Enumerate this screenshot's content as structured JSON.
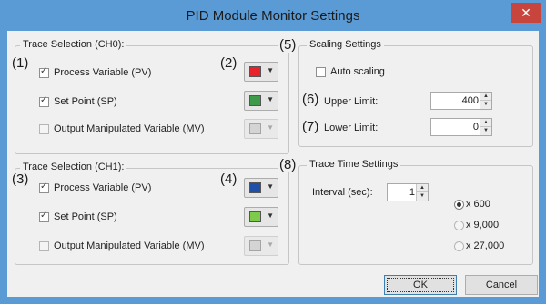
{
  "window": {
    "title": "PID Module Monitor Settings",
    "close_glyph": "✕"
  },
  "colors": {
    "frame": "#5b9bd5",
    "close": "#c7453d",
    "red": "#e8222b",
    "green": "#3d9a49",
    "blue": "#1f4fa6",
    "lightgreen": "#7ecb4b",
    "disabled_swatch": "#d4d4d4"
  },
  "ch0": {
    "legend": "Trace Selection (CH0):",
    "pv_label": "Process Variable (PV)",
    "pv_checked": true,
    "pv_color": "red",
    "sp_label": "Set Point (SP)",
    "sp_checked": true,
    "sp_color": "green",
    "mv_label": "Output Manipulated Variable (MV)",
    "mv_checked": false,
    "mv_enabled": false
  },
  "ch1": {
    "legend": "Trace Selection (CH1):",
    "pv_label": "Process Variable (PV)",
    "pv_checked": true,
    "pv_color": "blue",
    "sp_label": "Set Point (SP)",
    "sp_checked": true,
    "sp_color": "lightgreen",
    "mv_label": "Output Manipulated Variable (MV)",
    "mv_checked": false,
    "mv_enabled": false
  },
  "scaling": {
    "legend": "Scaling Settings",
    "auto_label": "Auto scaling",
    "auto_checked": false,
    "upper_label": "Upper Limit:",
    "upper_value": "400",
    "lower_label": "Lower Limit:",
    "lower_value": "0"
  },
  "trace_time": {
    "legend": "Trace Time Settings",
    "interval_label": "Interval (sec):",
    "interval_value": "1",
    "options": [
      {
        "label": "x 600",
        "selected": true
      },
      {
        "label": "x 9,000",
        "selected": false
      },
      {
        "label": "x 27,000",
        "selected": false
      }
    ]
  },
  "callouts": [
    "(1)",
    "(2)",
    "(3)",
    "(4)",
    "(5)",
    "(6)",
    "(7)",
    "(8)"
  ],
  "buttons": {
    "ok": "OK",
    "cancel": "Cancel"
  }
}
